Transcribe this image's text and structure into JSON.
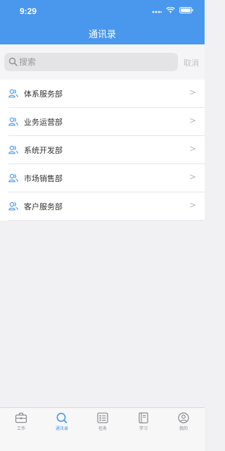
{
  "status_bar": {
    "time": "9:29"
  },
  "header": {
    "title": "通讯录"
  },
  "search": {
    "placeholder": "搜索",
    "value": "",
    "cancel_label": "取消"
  },
  "departments": [
    {
      "label": "体系服务部",
      "chevron": ">"
    },
    {
      "label": "业务运营部",
      "chevron": ">"
    },
    {
      "label": "系统开发部",
      "chevron": ">"
    },
    {
      "label": "市场销售部",
      "chevron": ">"
    },
    {
      "label": "客户服务部",
      "chevron": ">"
    }
  ],
  "tabbar": {
    "items": [
      {
        "label": "工作",
        "icon": "briefcase-icon",
        "active": false
      },
      {
        "label": "通讯录",
        "icon": "search-icon",
        "active": true
      },
      {
        "label": "任务",
        "icon": "task-list-icon",
        "active": false
      },
      {
        "label": "学习",
        "icon": "book-icon",
        "active": false
      },
      {
        "label": "我的",
        "icon": "profile-icon",
        "active": false
      }
    ]
  },
  "colors": {
    "accent": "#4a97ee",
    "header_bg": "#4a97ee",
    "page_bg": "#f1f1f3"
  }
}
